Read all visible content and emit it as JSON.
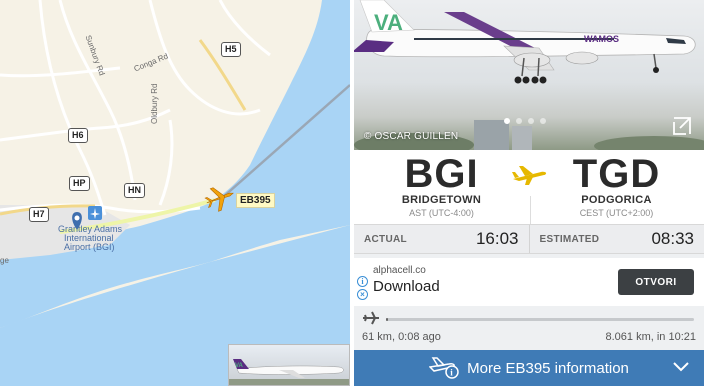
{
  "map": {
    "roads": {
      "h5": "H5",
      "h6": "H6",
      "hp": "HP",
      "hn": "HN",
      "h7": "H7"
    },
    "street_labels": {
      "sunbury": "Sunbury Rd",
      "conga": "Conga Rd",
      "oldbury": "Oldbury Rd"
    },
    "airport_label_line1": "Grantley Adams",
    "airport_label_line2": "International",
    "airport_label_line3": "Airport (BGI)",
    "edge_label": "ge",
    "flight_tag": "EB395"
  },
  "photo": {
    "credit": "© OSCAR GUILLEN",
    "airline_logo": "VA",
    "fuselage_text": "WAMOS",
    "page_dots": 4,
    "active_dot": 0
  },
  "route": {
    "origin_code": "BGI",
    "origin_city": "BRIDGETOWN",
    "origin_tz": "AST (UTC-4:00)",
    "dest_code": "TGD",
    "dest_city": "PODGORICA",
    "dest_tz": "CEST (UTC+2:00)"
  },
  "times": {
    "actual_label": "ACTUAL",
    "actual_value": "16:03",
    "estimated_label": "ESTIMATED",
    "estimated_value": "08:33"
  },
  "ad": {
    "domain": "alphacell.co",
    "title": "Download",
    "button": "OTVORI"
  },
  "progress": {
    "fraction": 0.008,
    "left_text": "61 km, 0:08 ago",
    "right_text": "8.061 km, in 10:21"
  },
  "more": {
    "label": "More EB395 information"
  },
  "colors": {
    "accent_bar": "#3f7bb6",
    "plane_icon": "#e6b800",
    "flight_tag_bg": "#fff9c4",
    "sea": "#a9d4f5"
  }
}
